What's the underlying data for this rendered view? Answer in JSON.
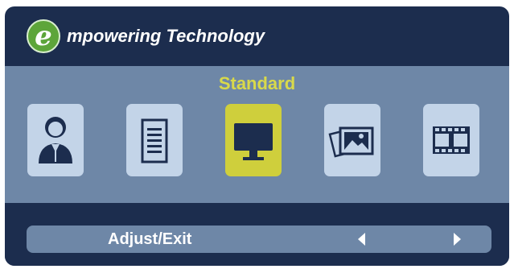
{
  "header": {
    "logo_letter": "e",
    "brand_text": "mpowering Technology"
  },
  "modes": {
    "current_mode": "Standard",
    "selected_index": 2,
    "items": [
      {
        "icon": "user-icon"
      },
      {
        "icon": "document-icon"
      },
      {
        "icon": "monitor-icon"
      },
      {
        "icon": "photo-icon"
      },
      {
        "icon": "film-icon"
      }
    ]
  },
  "footer": {
    "adjust_label": "Adjust/Exit",
    "left_arrow_icon": "triangle-left-icon",
    "right_arrow_icon": "triangle-right-icon"
  },
  "colors": {
    "panel_dark": "#1c2d4e",
    "strip": "#6e87a7",
    "tile": "#c3d4e8",
    "tile_selected": "#cfcf3c",
    "mode_title": "#d9d94a",
    "logo_green": "#5da53a",
    "icon_dark": "#1c2d4e"
  }
}
